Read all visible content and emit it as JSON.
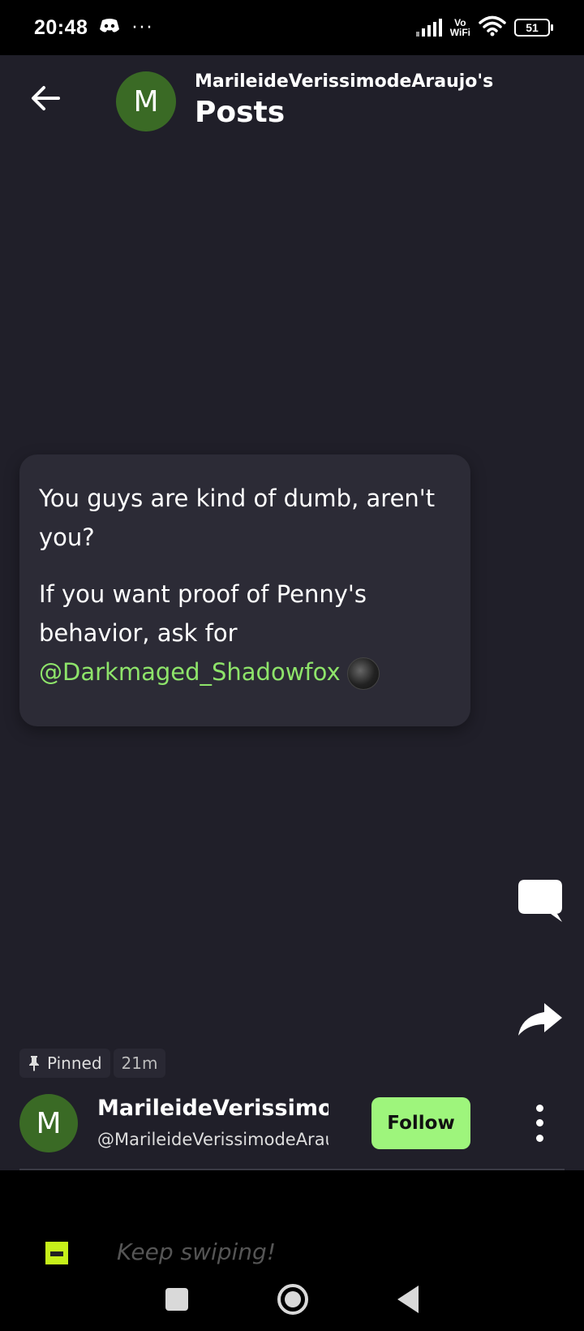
{
  "status_bar": {
    "time": "20:48",
    "dots": "···",
    "vowifi_top": "Vo",
    "vowifi_bottom": "WiFi",
    "battery": "51",
    "icons": [
      "discord-icon",
      "signal-icon",
      "wifi-icon",
      "battery-icon"
    ]
  },
  "header": {
    "avatar_letter": "M",
    "subtitle": "MarileideVerissimodeAraujo's",
    "title": "Posts",
    "avatar_color": "#3a6a25"
  },
  "post": {
    "paragraph1": "You guys are kind of dumb, aren't you?",
    "paragraph2_prefix": "If you want proof of Penny's behavior, ask for",
    "mention": "@Darkmaged_Shadowfox",
    "mention_color": "#8ee46a"
  },
  "meta": {
    "pinned_label": "Pinned",
    "time_ago": "21m"
  },
  "author": {
    "avatar_letter": "M",
    "name": "MarileideVerissimodeAraujo",
    "handle": "@MarileideVerissimodeAraujo",
    "follow_label": "Follow",
    "follow_color": "#9ef57c"
  },
  "bottom": {
    "hint": "Keep swiping!"
  }
}
